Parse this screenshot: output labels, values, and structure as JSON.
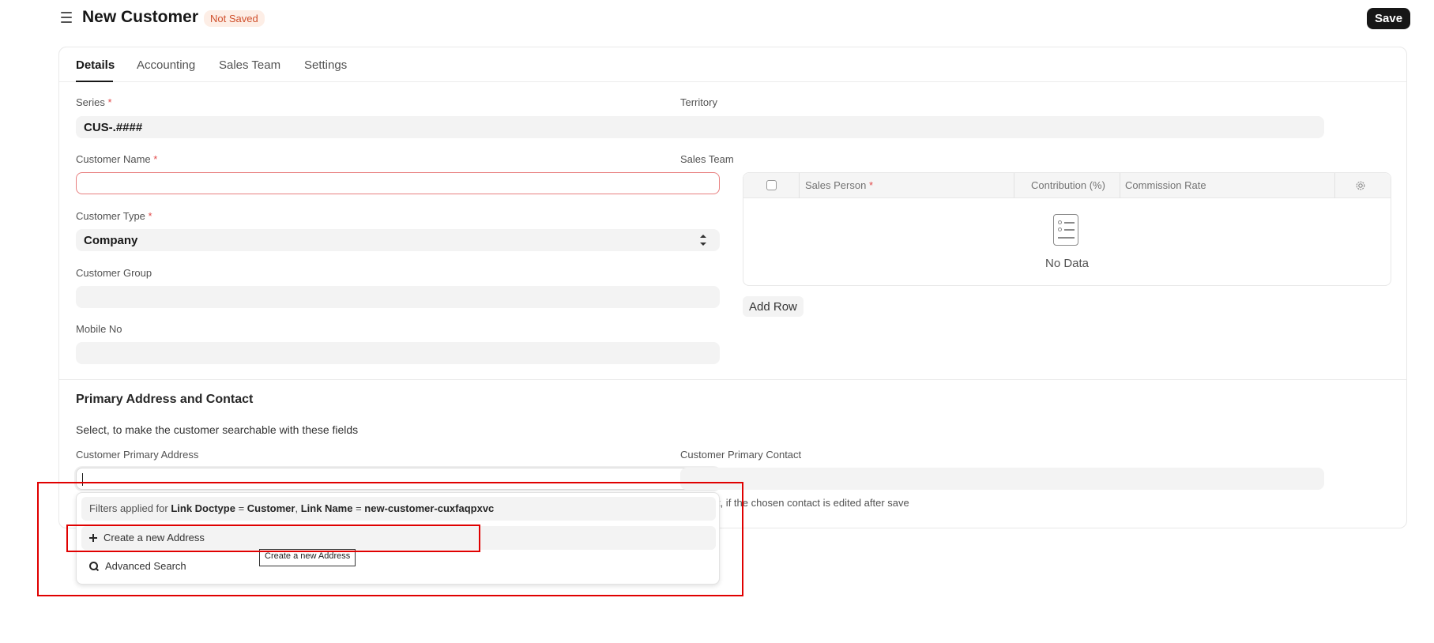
{
  "header": {
    "title": "New Customer",
    "status": "Not Saved",
    "save_label": "Save",
    "menu_icon": "hamburger-icon"
  },
  "tabs": [
    {
      "label": "Details",
      "active": true
    },
    {
      "label": "Accounting",
      "active": false
    },
    {
      "label": "Sales Team",
      "active": false
    },
    {
      "label": "Settings",
      "active": false
    }
  ],
  "fields": {
    "series_label": "Series",
    "series_value": "CUS-.####",
    "customer_name_label": "Customer Name",
    "customer_name_value": "",
    "customer_type_label": "Customer Type",
    "customer_type_value": "Company",
    "customer_group_label": "Customer Group",
    "mobile_no_label": "Mobile No",
    "territory_label": "Territory",
    "sales_team_label": "Sales Team",
    "required_mark": "*"
  },
  "sales_team_grid": {
    "columns": [
      "Sales Person",
      "Contribution (%)",
      "Commission Rate"
    ],
    "empty_text": "No Data",
    "add_row_label": "Add Row"
  },
  "address_section": {
    "title": "Primary Address and Contact",
    "description": "Select, to make the customer searchable with these fields",
    "primary_address_label": "Customer Primary Address",
    "primary_contact_label": "Customer Primary Contact",
    "contact_help": "Reselect, if the chosen contact is edited after save"
  },
  "dropdown": {
    "filter_prefix": "Filters applied for ",
    "filter_field1": "Link Doctype",
    "filter_eq1": " = ",
    "filter_value1": "Customer",
    "filter_sep": ", ",
    "filter_field2": "Link Name",
    "filter_eq2": " = ",
    "filter_value2": "new-customer-cuxfaqpxvc",
    "create_label": "Create a new Address",
    "advanced_label": "Advanced Search",
    "tooltip": "Create a new Address"
  },
  "colors": {
    "accent": "#171717",
    "annotation": "#e00000",
    "status": "#d0502c"
  }
}
